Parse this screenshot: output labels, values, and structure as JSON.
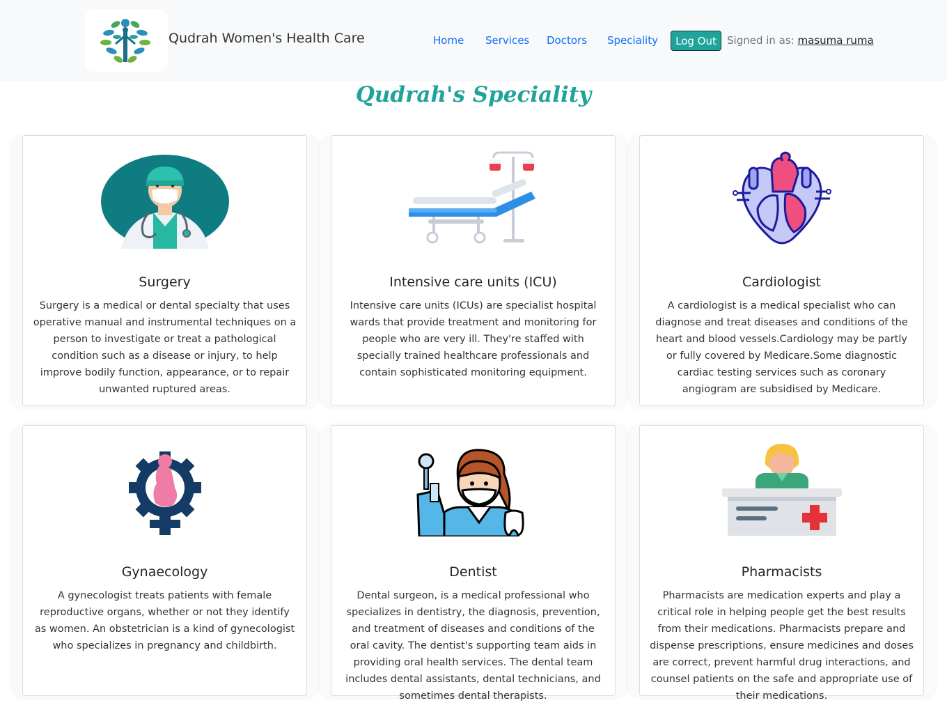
{
  "brand": {
    "name": "Qudrah Women's Health Care"
  },
  "nav": {
    "home": "Home",
    "services": "Services",
    "doctors": "Doctors",
    "speciality": "Speciality",
    "logout": "Log Out",
    "signed_in_label": "Signed in as:",
    "user_name": "masuma ruma"
  },
  "page_title": "Qudrah's Speciality",
  "cards": [
    {
      "icon": "surgeon-icon",
      "title": "Surgery",
      "description": "Surgery is a medical or dental specialty that uses operative manual and instrumental techniques on a person to investigate or treat a pathological condition such as a disease or injury, to help improve bodily function, appearance, or to repair unwanted ruptured areas."
    },
    {
      "icon": "hospital-bed-icon",
      "title": "Intensive care units (ICU)",
      "description": "Intensive care units (ICUs) are specialist hospital wards that provide treatment and monitoring for people who are very ill. They're staffed with specially trained healthcare professionals and contain sophisticated monitoring equipment."
    },
    {
      "icon": "heart-icon",
      "title": "Cardiologist",
      "description": "A cardiologist is a medical specialist who can diagnose and treat diseases and conditions of the heart and blood vessels.Cardiology may be partly or fully covered by Medicare.Some diagnostic cardiac testing services such as coronary angiogram are subsidised by Medicare."
    },
    {
      "icon": "gynaecology-icon",
      "title": "Gynaecology",
      "description": "A gynecologist treats patients with female reproductive organs, whether or not they identify as women. An obstetrician is a kind of gynecologist who specializes in pregnancy and childbirth."
    },
    {
      "icon": "dentist-icon",
      "title": "Dentist",
      "description": "Dental surgeon, is a medical professional who specializes in dentistry, the diagnosis, prevention, and treatment of diseases and conditions of the oral cavity. The dentist's supporting team aids in providing oral health services. The dental team includes dental assistants, dental technicians, and sometimes dental therapists."
    },
    {
      "icon": "pharmacist-icon",
      "title": "Pharmacists",
      "description": "Pharmacists are medication experts and play a critical role in helping people get the best results from their medications. Pharmacists prepare and dispense prescriptions, ensure medicines and doses are correct, prevent harmful drug interactions, and counsel patients on the safe and appropriate use of their medications."
    }
  ],
  "colors": {
    "accent": "#20a39a",
    "link": "#0d6efd",
    "navbar_bg": "#f8f9fa"
  }
}
